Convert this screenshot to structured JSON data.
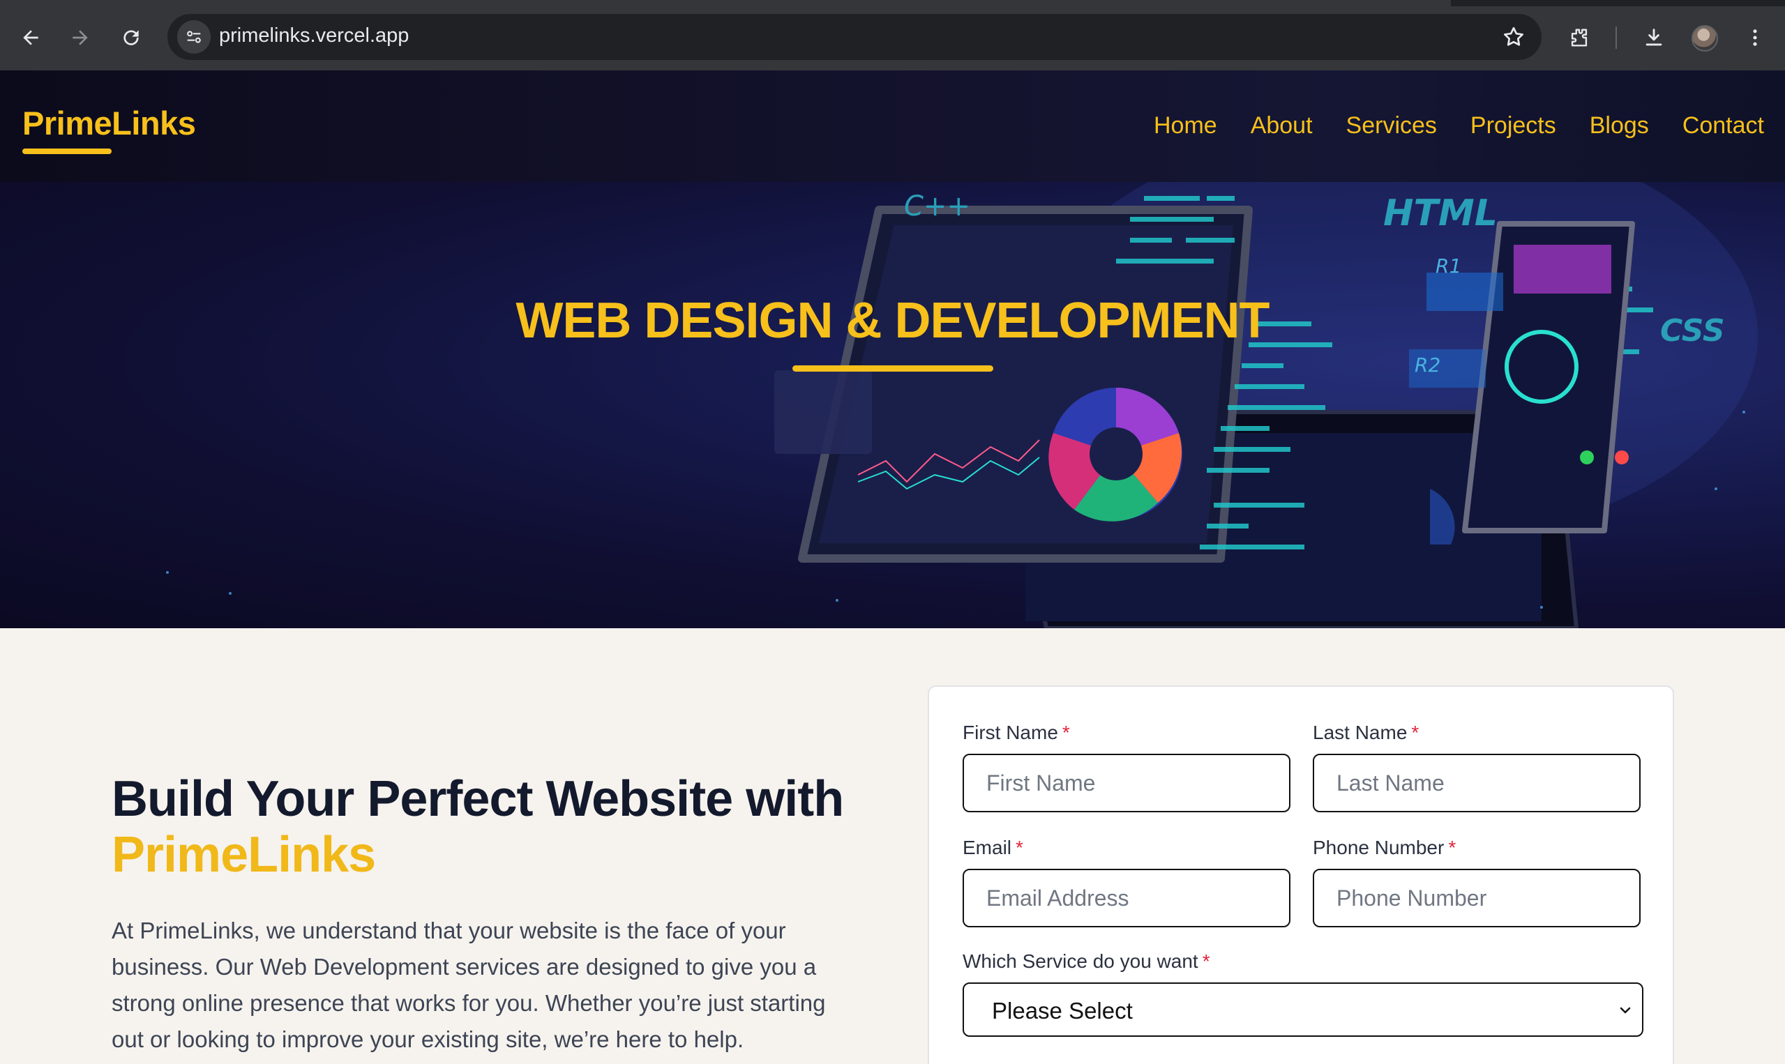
{
  "browser": {
    "url": "primelinks.vercel.app"
  },
  "site": {
    "logo": "PrimeLinks",
    "nav": [
      "Home",
      "About",
      "Services",
      "Projects",
      "Blogs",
      "Contact"
    ],
    "brand_color": "#f8c01b"
  },
  "hero": {
    "title": "WEB DESIGN & DEVELOPMENT",
    "art_labels": {
      "cpp": "C++",
      "html": "HTML",
      "css": "CSS",
      "r1": "R1",
      "r2": "R2"
    }
  },
  "intro": {
    "heading_line1": "Build Your Perfect Website with",
    "heading_line2": "PrimeLinks",
    "paragraph": "At PrimeLinks, we understand that your website is the face of your business. Our Web Development services are designed to give you a strong online presence that works for you. Whether you’re just starting out or looking to improve your existing site, we’re here to help."
  },
  "form": {
    "first_name": {
      "label": "First Name",
      "required": "*",
      "placeholder": "First Name"
    },
    "last_name": {
      "label": "Last Name",
      "required": "*",
      "placeholder": "Last Name"
    },
    "email": {
      "label": "Email",
      "required": "*",
      "placeholder": "Email Address"
    },
    "phone": {
      "label": "Phone Number",
      "required": "*",
      "placeholder": "Phone Number"
    },
    "service": {
      "label": "Which Service do you want",
      "required": "*",
      "selected": "Please Select"
    }
  },
  "icons": [
    "back-icon",
    "forward-icon",
    "reload-icon",
    "site-info-icon",
    "star-icon",
    "extensions-icon",
    "download-icon",
    "menu-icon",
    "chevron-down-icon"
  ]
}
